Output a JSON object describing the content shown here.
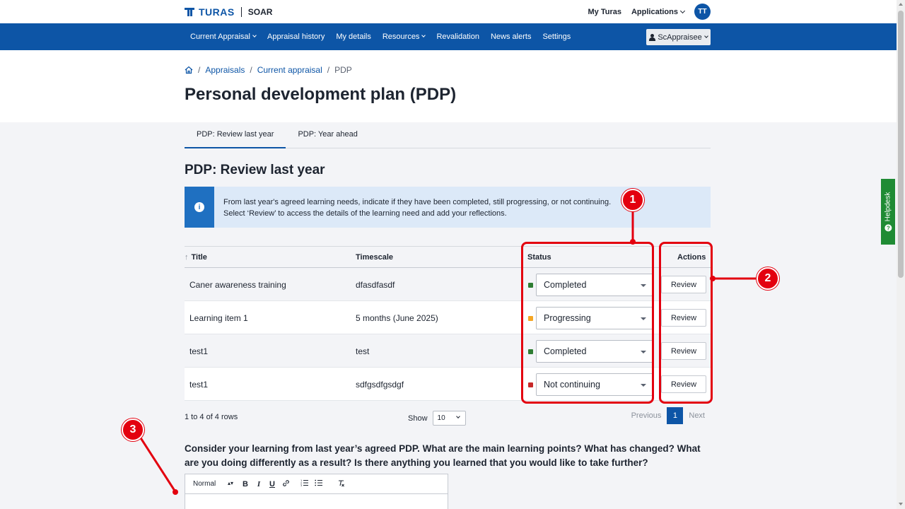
{
  "header": {
    "logo_text": "TURAS",
    "logo_sub": "SOAR",
    "my_turas": "My Turas",
    "applications": "Applications",
    "avatar_initials": "TT"
  },
  "nav": {
    "items": [
      "Current Appraisal",
      "Appraisal history",
      "My details",
      "Resources",
      "Revalidation",
      "News alerts",
      "Settings"
    ],
    "user": "ScAppraisee"
  },
  "breadcrumb": {
    "items": [
      "Appraisals",
      "Current appraisal"
    ],
    "current": "PDP"
  },
  "page_title": "Personal development plan (PDP)",
  "tabs": [
    {
      "label": "PDP: Review last year",
      "active": true
    },
    {
      "label": "PDP: Year ahead",
      "active": false
    }
  ],
  "section_title": "PDP: Review last year",
  "info": {
    "line1": "From last year's agreed learning needs, indicate if they have been completed, still progressing, or not continuing.",
    "line2": "Select ‘Review’ to access the details of the learning need and add your reflections."
  },
  "table": {
    "headers": {
      "title": "Title",
      "timescale": "Timescale",
      "status": "Status",
      "actions": "Actions"
    },
    "rows": [
      {
        "title": "Caner awareness training",
        "timescale": "dfasdfasdf",
        "status": "Completed",
        "status_color": "#2e7d32",
        "action": "Review"
      },
      {
        "title": "Learning item 1",
        "timescale": "5 months (June 2025)",
        "status": "Progressing",
        "status_color": "#f5a623",
        "action": "Review"
      },
      {
        "title": "test1",
        "timescale": "test",
        "status": "Completed",
        "status_color": "#2e7d32",
        "action": "Review"
      },
      {
        "title": "test1",
        "timescale": "sdfgsdfgsdgf",
        "status": "Not continuing",
        "status_color": "#c62828",
        "action": "Review"
      }
    ],
    "rows_count": "1 to 4 of 4 rows",
    "show_label": "Show",
    "show_value": "10",
    "pager": {
      "previous": "Previous",
      "page": "1",
      "next": "Next"
    }
  },
  "question": "Consider your learning from last year’s agreed PDP. What are the main learning points? What has changed? What are you doing differently as a result? Is there anything you learned that you would like to take further?",
  "editor": {
    "format": "Normal",
    "buttons": [
      "B",
      "I",
      "U"
    ]
  },
  "helpdesk": "Helpdesk",
  "annotations": [
    "1",
    "2",
    "3"
  ],
  "colors": {
    "brand": "#0d55a6",
    "annotation": "#e3000f",
    "helpdesk": "#1f8b34"
  }
}
